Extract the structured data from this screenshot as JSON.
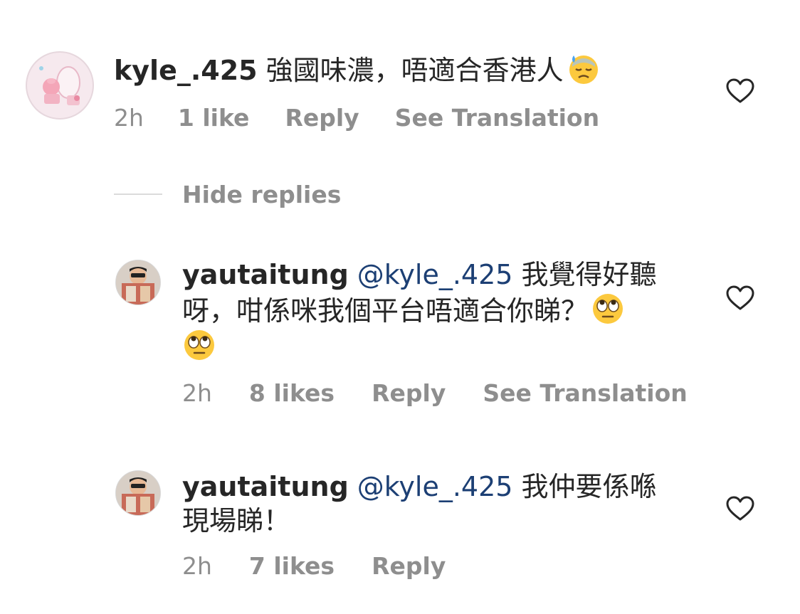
{
  "comments": [
    {
      "username": "kyle_.425",
      "text": "強國味濃，唔適合香港人",
      "emoji": "downcast-sweat-face",
      "time": "2h",
      "likes": "1 like",
      "reply": "Reply",
      "translate": "See Translation"
    }
  ],
  "hide_replies": "Hide replies",
  "replies": [
    {
      "username": "yautaitung",
      "mention": "@kyle_.425",
      "text_line1": "我覺得好聽",
      "text_line2": "呀，咁係咪我個平台唔適合你睇？",
      "time": "2h",
      "likes": "8 likes",
      "reply": "Reply",
      "translate": "See Translation"
    },
    {
      "username": "yautaitung",
      "mention": "@kyle_.425",
      "text_line1": "我仲要係喺",
      "text_line2": "現場睇！",
      "time": "2h",
      "likes": "7 likes",
      "reply": "Reply"
    }
  ],
  "icons": {
    "like": "heart-outline-icon",
    "eye_roll": "face-with-rolling-eyes-icon",
    "sweat": "downcast-face-with-sweat-icon"
  },
  "colors": {
    "text": "#262626",
    "secondary": "#8e8e8e",
    "mention": "#1c3f74",
    "divider": "#dbdbdb"
  }
}
